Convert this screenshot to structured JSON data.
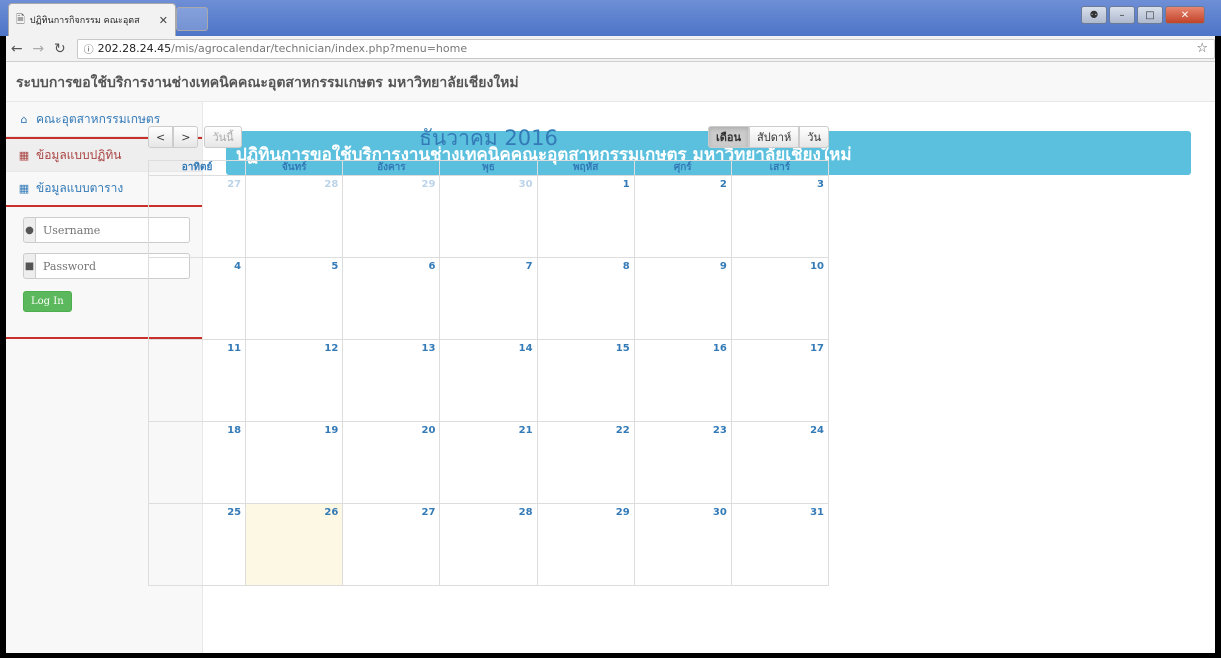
{
  "browser": {
    "tab_title": "ปฏิทินการกิจกรรม คณะอุตส",
    "url_host": "202.28.24.45",
    "url_path": "/mis/agrocalendar/technician/index.php?menu=home"
  },
  "site": {
    "header_title": "ระบบการขอใช้บริการงานช่างเทคนิคคณะอุตสาหกรรมเกษตร มหาวิทยาลัยเชียงใหม่"
  },
  "sidebar": {
    "items": [
      {
        "label": "คณะอุตสาหกรรมเกษตร",
        "icon": "home-icon"
      },
      {
        "label": "ข้อมูลแบบปฏิทิน",
        "icon": "calendar-icon"
      },
      {
        "label": "ข้อมูลแบบตาราง",
        "icon": "table-icon"
      }
    ],
    "login": {
      "username_placeholder": "Username",
      "password_placeholder": "Password",
      "login_label": "Log In"
    }
  },
  "main": {
    "banner_title": "ปฏิทินการขอใช้บริการงานช่างเทคนิคคณะอุตสาหกรรมเกษตร มหาวิทยาลัยเชียงใหม่"
  },
  "calendar": {
    "title": "ธันวาคม 2016",
    "prev_label": "<",
    "next_label": ">",
    "today_label": "วันนี้",
    "views": [
      "เดือน",
      "สัปดาห์",
      "วัน"
    ],
    "active_view": "เดือน",
    "weekdays": [
      "อาทิตย์",
      "จันทร์",
      "อังคาร",
      "พุธ",
      "พฤหัส",
      "ศุกร์",
      "เสาร์"
    ],
    "weeks": [
      [
        {
          "day": "27",
          "other": true
        },
        {
          "day": "28",
          "other": true
        },
        {
          "day": "29",
          "other": true
        },
        {
          "day": "30",
          "other": true
        },
        {
          "day": "1"
        },
        {
          "day": "2"
        },
        {
          "day": "3"
        }
      ],
      [
        {
          "day": "4"
        },
        {
          "day": "5"
        },
        {
          "day": "6"
        },
        {
          "day": "7"
        },
        {
          "day": "8"
        },
        {
          "day": "9"
        },
        {
          "day": "10"
        }
      ],
      [
        {
          "day": "11"
        },
        {
          "day": "12"
        },
        {
          "day": "13"
        },
        {
          "day": "14"
        },
        {
          "day": "15"
        },
        {
          "day": "16"
        },
        {
          "day": "17"
        }
      ],
      [
        {
          "day": "18"
        },
        {
          "day": "19"
        },
        {
          "day": "20"
        },
        {
          "day": "21"
        },
        {
          "day": "22"
        },
        {
          "day": "23"
        },
        {
          "day": "24"
        }
      ],
      [
        {
          "day": "25"
        },
        {
          "day": "26",
          "today": true
        },
        {
          "day": "27"
        },
        {
          "day": "28"
        },
        {
          "day": "29"
        },
        {
          "day": "30"
        },
        {
          "day": "31"
        }
      ]
    ]
  },
  "colors": {
    "banner": "#5bc0de",
    "link": "#337ab7",
    "accent_red": "#c9302c",
    "today": "#fcf8e3",
    "login_button": "#5cb85c"
  }
}
